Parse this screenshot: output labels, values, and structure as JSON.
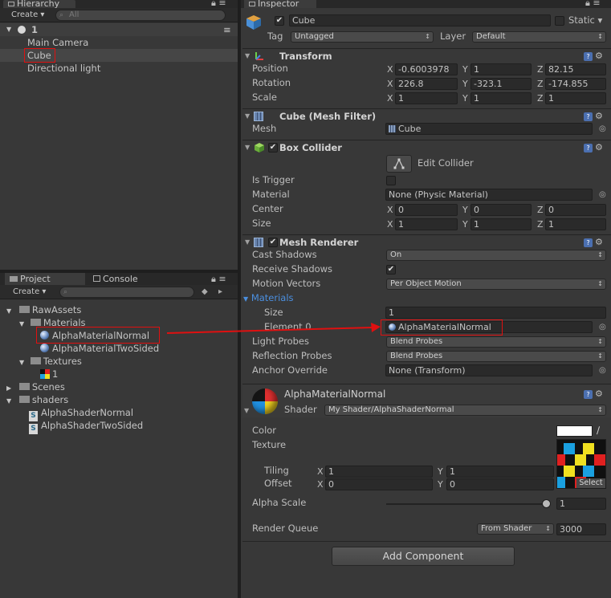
{
  "hierarchy": {
    "tab": "Hierarchy",
    "create": "Create",
    "search_placeholder": "All",
    "scene": "1",
    "items": [
      "Main Camera",
      "Cube",
      "Directional light"
    ]
  },
  "project": {
    "tabs": [
      "Project",
      "Console"
    ],
    "create": "Create",
    "tree": [
      {
        "label": "RawAssets"
      },
      {
        "label": "Materials"
      },
      {
        "label": "AlphaMaterialNormal"
      },
      {
        "label": "AlphaMaterialTwoSided"
      },
      {
        "label": "Textures"
      },
      {
        "label": "1"
      },
      {
        "label": "Scenes"
      },
      {
        "label": "shaders"
      },
      {
        "label": "AlphaShaderNormal"
      },
      {
        "label": "AlphaShaderTwoSided"
      }
    ]
  },
  "inspector": {
    "tab": "Inspector",
    "object_name": "Cube",
    "static_label": "Static",
    "tag_label": "Tag",
    "tag_value": "Untagged",
    "layer_label": "Layer",
    "layer_value": "Default",
    "transform": {
      "title": "Transform",
      "position_label": "Position",
      "rotation_label": "Rotation",
      "scale_label": "Scale",
      "position": [
        "-0.6003978",
        "1",
        "82.15"
      ],
      "rotation": [
        "226.8",
        "-323.1",
        "-174.855"
      ],
      "scale": [
        "1",
        "1",
        "1"
      ]
    },
    "axes": [
      "X",
      "Y",
      "Z"
    ],
    "mesh_filter": {
      "title": "Cube (Mesh Filter)",
      "mesh_label": "Mesh",
      "mesh_value": "Cube"
    },
    "box_collider": {
      "title": "Box Collider",
      "edit_label": "Edit Collider",
      "is_trigger_label": "Is Trigger",
      "material_label": "Material",
      "material_value": "None (Physic Material)",
      "center_label": "Center",
      "center": [
        "0",
        "0",
        "0"
      ],
      "size_label": "Size",
      "size": [
        "1",
        "1",
        "1"
      ]
    },
    "mesh_renderer": {
      "title": "Mesh Renderer",
      "cast_shadows_label": "Cast Shadows",
      "cast_shadows_value": "On",
      "receive_shadows_label": "Receive Shadows",
      "motion_vectors_label": "Motion Vectors",
      "motion_vectors_value": "Per Object Motion",
      "materials_label": "Materials",
      "size_label": "Size",
      "size_value": "1",
      "element0_label": "Element 0",
      "element0_value": "AlphaMaterialNormal",
      "light_probes_label": "Light Probes",
      "light_probes_value": "Blend Probes",
      "reflection_probes_label": "Reflection Probes",
      "reflection_probes_value": "Blend Probes",
      "anchor_label": "Anchor Override",
      "anchor_value": "None (Transform)"
    },
    "material": {
      "title": "AlphaMaterialNormal",
      "shader_label": "Shader",
      "shader_value": "My Shader/AlphaShaderNormal",
      "color_label": "Color",
      "texture_label": "Texture",
      "tiling_label": "Tiling",
      "tiling": [
        "1",
        "1"
      ],
      "offset_label": "Offset",
      "offset": [
        "0",
        "0"
      ],
      "select_label": "Select",
      "alpha_label": "Alpha Scale",
      "alpha_value": "1",
      "alpha_fraction": 1.0,
      "queue_label": "Render Queue",
      "queue_mode": "From Shader",
      "queue_value": "3000"
    },
    "add_component": "Add Component"
  },
  "colors": {
    "highlight_red": "#e01010",
    "accent_blue": "#4b8fe0"
  }
}
